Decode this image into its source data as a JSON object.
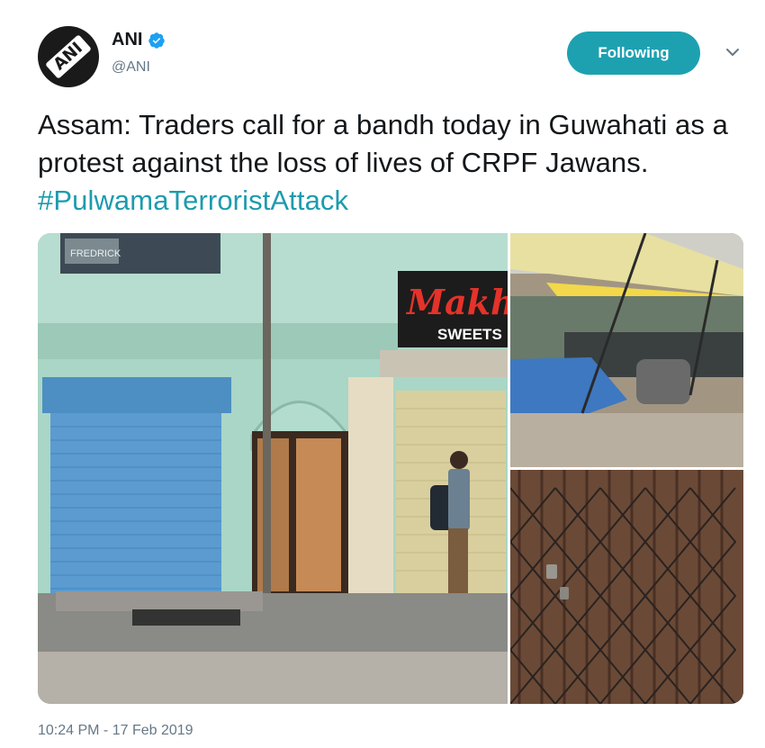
{
  "author": {
    "display_name": "ANI",
    "handle": "@ANI",
    "avatar_text": "ANI",
    "verified": true,
    "verified_icon": "verified-badge-icon"
  },
  "follow_button": {
    "label": "Following"
  },
  "menu": {
    "icon": "chevron-down-icon"
  },
  "tweet": {
    "text": "Assam: Traders call for a bandh today in Guwahati as a protest against the loss of lives of CRPF Jawans. ",
    "hashtag": "#PulwamaTerroristAttack"
  },
  "media": {
    "sign_top": "Makh",
    "sign_bottom": "SWEETS",
    "sign_small": "FREDRICK"
  },
  "timestamp": "10:24 PM - 17 Feb 2019",
  "colors": {
    "accent": "#1da1b0",
    "hashtag": "#1d9bae",
    "secondary_text": "#657786",
    "verified": "#1da1f2"
  }
}
